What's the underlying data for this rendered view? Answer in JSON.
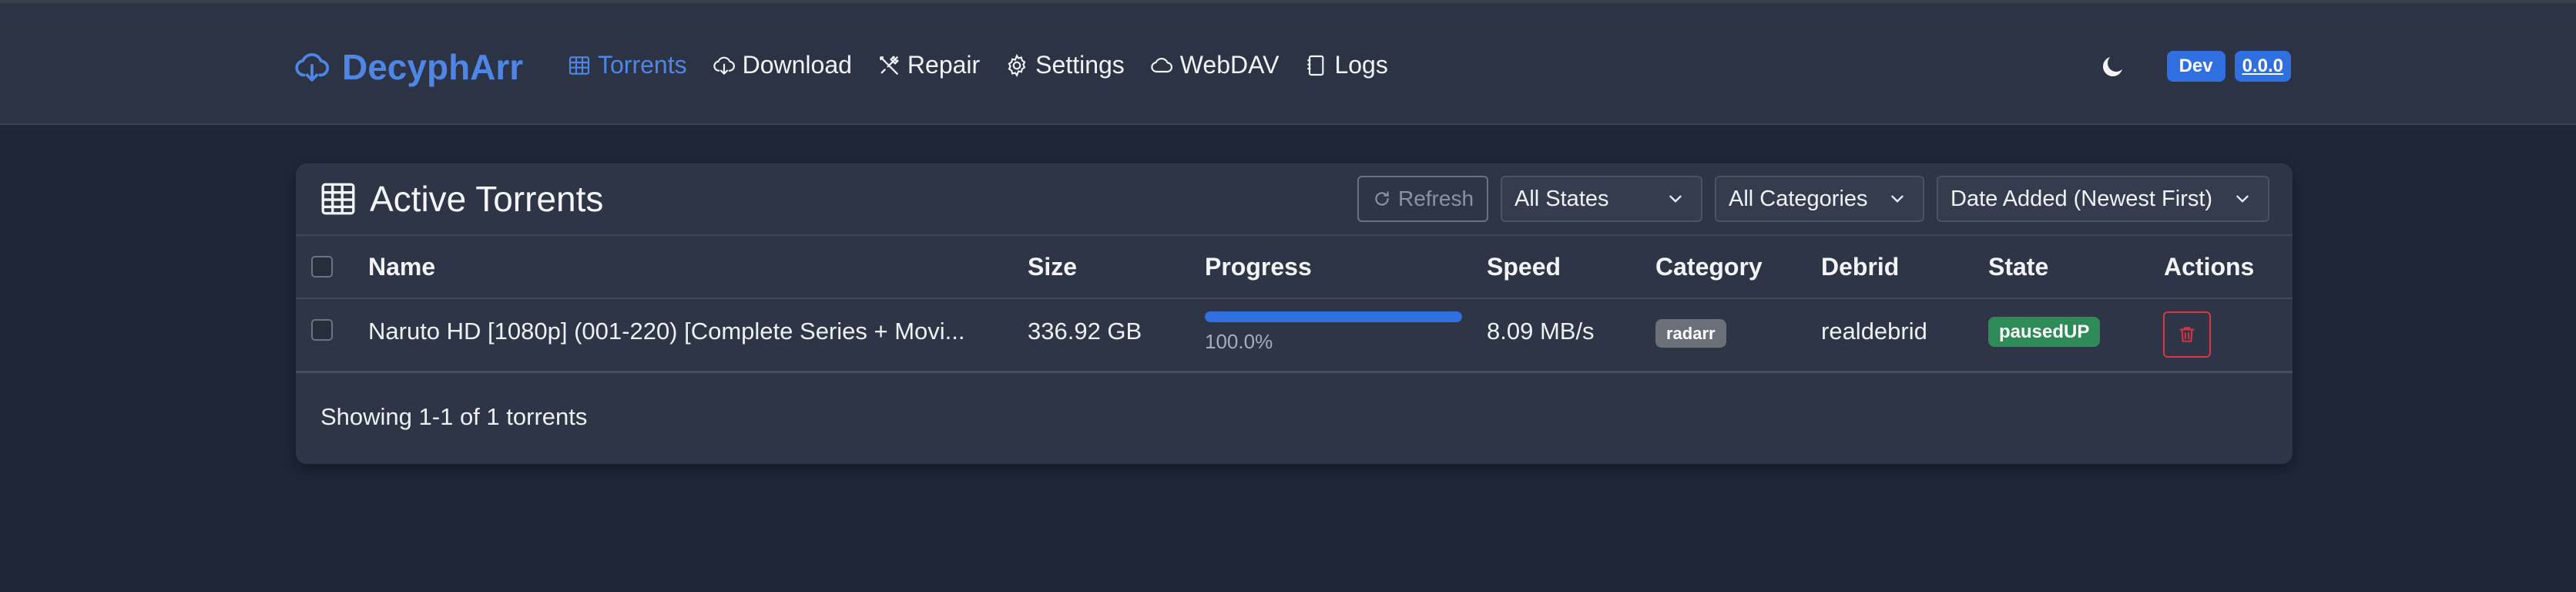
{
  "app": {
    "name": "DecyphArr",
    "env_badge": "Dev",
    "version": "0.0.0"
  },
  "nav": {
    "items": [
      {
        "label": "Torrents",
        "icon": "table-icon",
        "active": true
      },
      {
        "label": "Download",
        "icon": "cloud-download-icon",
        "active": false
      },
      {
        "label": "Repair",
        "icon": "tools-icon",
        "active": false
      },
      {
        "label": "Settings",
        "icon": "gear-icon",
        "active": false
      },
      {
        "label": "WebDAV",
        "icon": "cloud-icon",
        "active": false
      },
      {
        "label": "Logs",
        "icon": "journal-icon",
        "active": false
      }
    ]
  },
  "card": {
    "title": "Active Torrents",
    "refresh_label": "Refresh",
    "filters": {
      "state": "All States",
      "category": "All Categories",
      "sort": "Date Added (Newest First)"
    },
    "columns": [
      "Name",
      "Size",
      "Progress",
      "Speed",
      "Category",
      "Debrid",
      "State",
      "Actions"
    ],
    "rows": [
      {
        "name": "Naruto HD [1080p] (001-220) [Complete Series + Movi...",
        "size": "336.92 GB",
        "progress_percent": 100,
        "progress_text": "100.0%",
        "speed": "8.09 MB/s",
        "category": "radarr",
        "debrid": "realdebrid",
        "state": "pausedUP"
      }
    ],
    "footer": "Showing 1-1 of 1 torrents"
  },
  "colors": {
    "accent": "#2f6fe0",
    "brand": "#4f86e6",
    "state_badge": "#2e8b57",
    "delete": "#dc3545"
  }
}
